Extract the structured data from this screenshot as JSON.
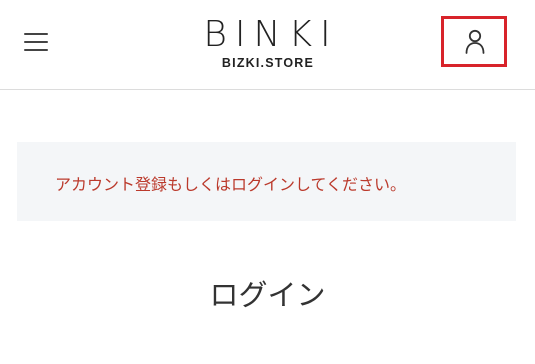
{
  "header": {
    "menu_icon": "hamburger-menu-icon",
    "logo": {
      "mark": "BINKI",
      "subtitle": "BIZKI.STORE"
    },
    "account_icon": "user-account-icon",
    "highlight_color": "#d8232a"
  },
  "notice": {
    "text": "アカウント登録もしくはログインしてください。",
    "color": "#bb3a2c",
    "background": "#f4f6f8"
  },
  "main": {
    "title": "ログイン"
  }
}
